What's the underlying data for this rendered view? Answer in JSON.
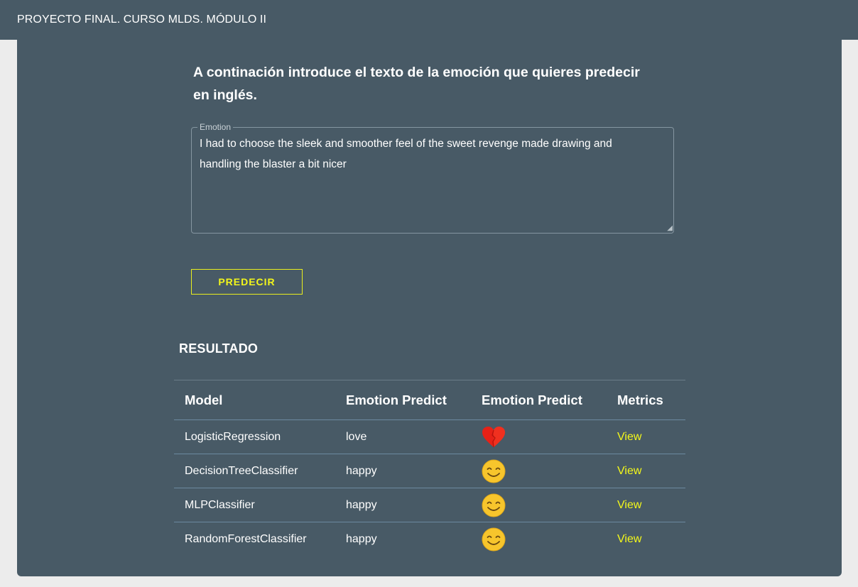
{
  "appbar": {
    "title": "PROYECTO FINAL. CURSO MLDS. MÓDULO II"
  },
  "form": {
    "heading_line1": "A continación introduce el texto de la emoción que quieres predecir",
    "heading_line2": "en inglés.",
    "field_label": "Emotion",
    "field_value": "I had to choose the sleek and smoother feel of the sweet revenge made drawing and handling the blaster a bit nicer",
    "submit_label": "PREDECIR"
  },
  "results": {
    "title": "RESULTADO",
    "columns": [
      "Model",
      "Emotion Predict",
      "Emotion Predict",
      "Metrics"
    ],
    "rows": [
      {
        "model": "LogisticRegression",
        "emotion": "love",
        "icon": "heart-icon",
        "metrics": "View"
      },
      {
        "model": "DecisionTreeClassifier",
        "emotion": "happy",
        "icon": "smiley-icon",
        "metrics": "View"
      },
      {
        "model": "MLPClassifier",
        "emotion": "happy",
        "icon": "smiley-icon",
        "metrics": "View"
      },
      {
        "model": "RandomForestClassifier",
        "emotion": "happy",
        "icon": "smiley-icon",
        "metrics": "View"
      }
    ]
  },
  "colors": {
    "primary": "#485a66",
    "accent": "#f2f61b",
    "background": "#ececec"
  }
}
